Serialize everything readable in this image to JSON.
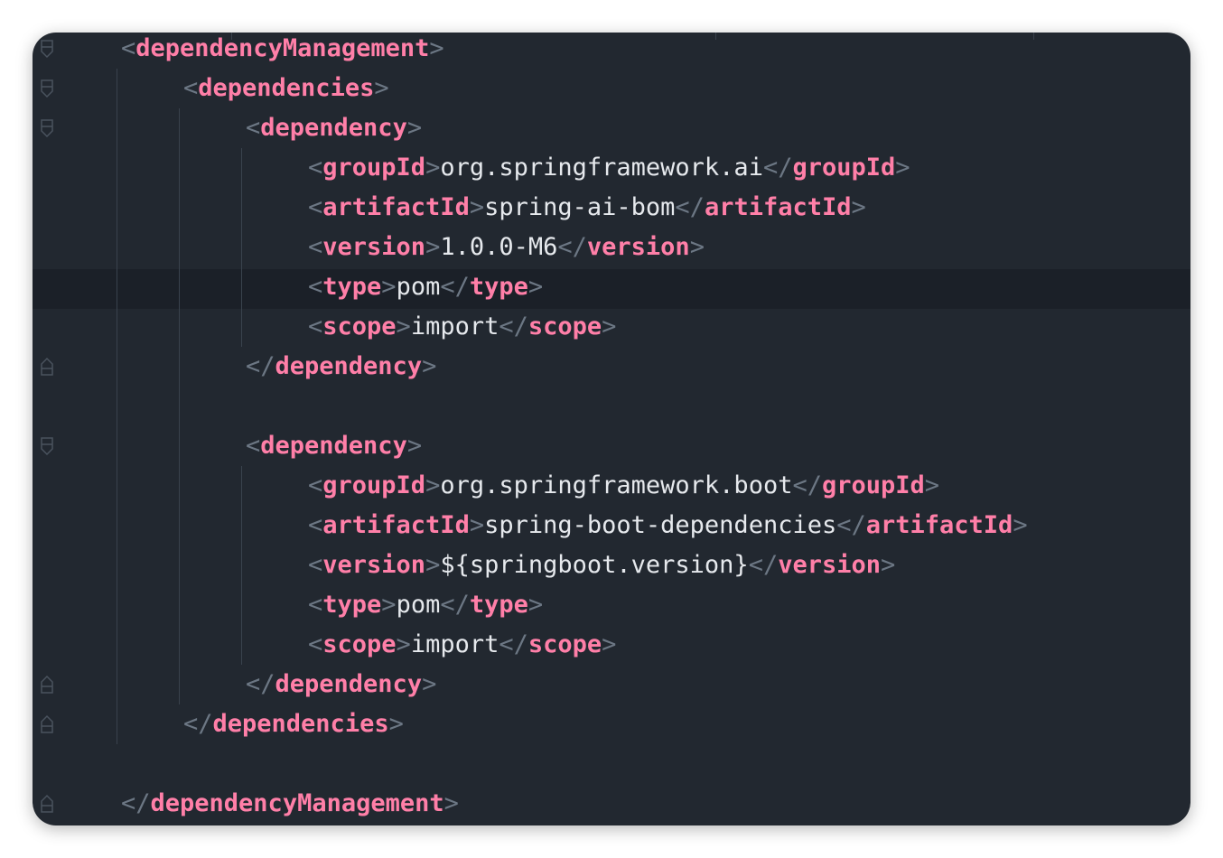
{
  "editor": {
    "language": "xml",
    "colors": {
      "background": "#222830",
      "current_line": "#1b2028",
      "tag": "#ff7fa8",
      "bracket": "#6c7784",
      "text": "#e6e9ed"
    },
    "lines": [
      {
        "indent": 0,
        "kind": "open",
        "tag": "dependencyManagement"
      },
      {
        "indent": 1,
        "kind": "open",
        "tag": "dependencies"
      },
      {
        "indent": 2,
        "kind": "open",
        "tag": "dependency"
      },
      {
        "indent": 3,
        "kind": "elem",
        "tag": "groupId",
        "value": "org.springframework.ai"
      },
      {
        "indent": 3,
        "kind": "elem",
        "tag": "artifactId",
        "value": "spring-ai-bom"
      },
      {
        "indent": 3,
        "kind": "elem",
        "tag": "version",
        "value": "1.0.0-M6"
      },
      {
        "indent": 3,
        "kind": "elem",
        "tag": "type",
        "value": "pom",
        "current": true
      },
      {
        "indent": 3,
        "kind": "elem",
        "tag": "scope",
        "value": "import"
      },
      {
        "indent": 2,
        "kind": "close",
        "tag": "dependency"
      },
      {
        "indent": 0,
        "kind": "blank"
      },
      {
        "indent": 2,
        "kind": "open",
        "tag": "dependency"
      },
      {
        "indent": 3,
        "kind": "elem",
        "tag": "groupId",
        "value": "org.springframework.boot"
      },
      {
        "indent": 3,
        "kind": "elem",
        "tag": "artifactId",
        "value": "spring-boot-dependencies"
      },
      {
        "indent": 3,
        "kind": "elem",
        "tag": "version",
        "value": "${springboot.version}"
      },
      {
        "indent": 3,
        "kind": "elem",
        "tag": "type",
        "value": "pom"
      },
      {
        "indent": 3,
        "kind": "elem",
        "tag": "scope",
        "value": "import"
      },
      {
        "indent": 2,
        "kind": "close",
        "tag": "dependency"
      },
      {
        "indent": 1,
        "kind": "close",
        "tag": "dependencies"
      },
      {
        "indent": 0,
        "kind": "blank"
      },
      {
        "indent": 0,
        "kind": "close",
        "tag": "dependencyManagement"
      }
    ],
    "fold_markers": [
      {
        "line": 0,
        "type": "fold-open"
      },
      {
        "line": 1,
        "type": "fold-open"
      },
      {
        "line": 2,
        "type": "fold-open"
      },
      {
        "line": 8,
        "type": "fold-close"
      },
      {
        "line": 10,
        "type": "fold-open"
      },
      {
        "line": 16,
        "type": "fold-close"
      },
      {
        "line": 17,
        "type": "fold-close"
      },
      {
        "line": 19,
        "type": "fold-close"
      }
    ]
  }
}
